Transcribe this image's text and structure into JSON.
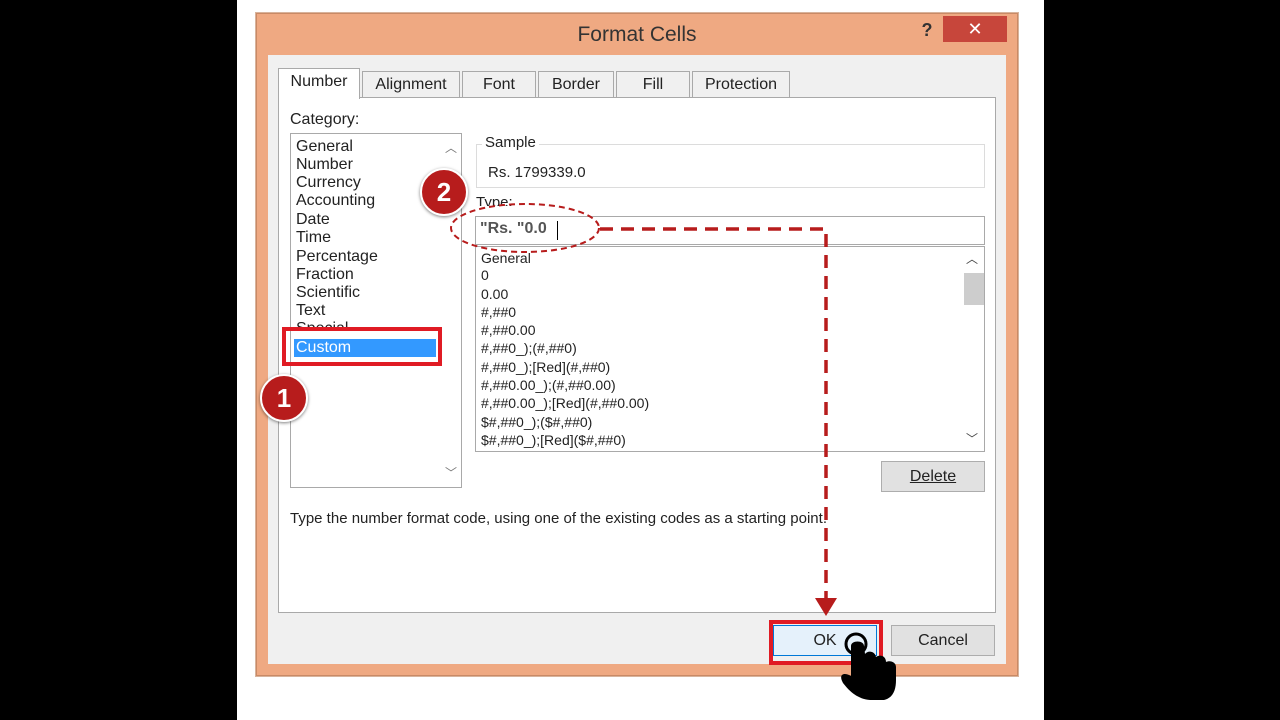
{
  "dialog": {
    "title": "Format Cells",
    "help_label": "?",
    "close_label": "✕",
    "tabs": [
      {
        "label": "Number"
      },
      {
        "label": "Alignment"
      },
      {
        "label": "Font"
      },
      {
        "label": "Border"
      },
      {
        "label": "Fill"
      },
      {
        "label": "Protection"
      }
    ],
    "category_label": "Category:",
    "categories": [
      {
        "label": "General"
      },
      {
        "label": "Number"
      },
      {
        "label": "Currency"
      },
      {
        "label": "Accounting"
      },
      {
        "label": "Date"
      },
      {
        "label": "Time"
      },
      {
        "label": "Percentage"
      },
      {
        "label": "Fraction"
      },
      {
        "label": "Scientific"
      },
      {
        "label": "Text"
      },
      {
        "label": "Special"
      },
      {
        "label": "Custom"
      }
    ],
    "selected_category": "Custom",
    "sample_label": "Sample",
    "sample_value": "Rs. 1799339.0",
    "type_label": "Type:",
    "type_value": "\"Rs. \"0.0",
    "formats": [
      {
        "label": "General"
      },
      {
        "label": "0"
      },
      {
        "label": "0.00"
      },
      {
        "label": "#,##0"
      },
      {
        "label": "#,##0.00"
      },
      {
        "label": "#,##0_);(#,##0)"
      },
      {
        "label": "#,##0_);[Red](#,##0)"
      },
      {
        "label": "#,##0.00_);(#,##0.00)"
      },
      {
        "label": "#,##0.00_);[Red](#,##0.00)"
      },
      {
        "label": "$#,##0_);($#,##0)"
      },
      {
        "label": "$#,##0_);[Red]($#,##0)"
      }
    ],
    "delete_label": "Delete",
    "hint": "Type the number format code, using one of the existing codes as a starting point.",
    "ok_label": "OK",
    "cancel_label": "Cancel"
  },
  "annotations": {
    "step1": "1",
    "step2": "2",
    "accent_color": "#e01b24",
    "badge_color": "#b71c1c"
  }
}
